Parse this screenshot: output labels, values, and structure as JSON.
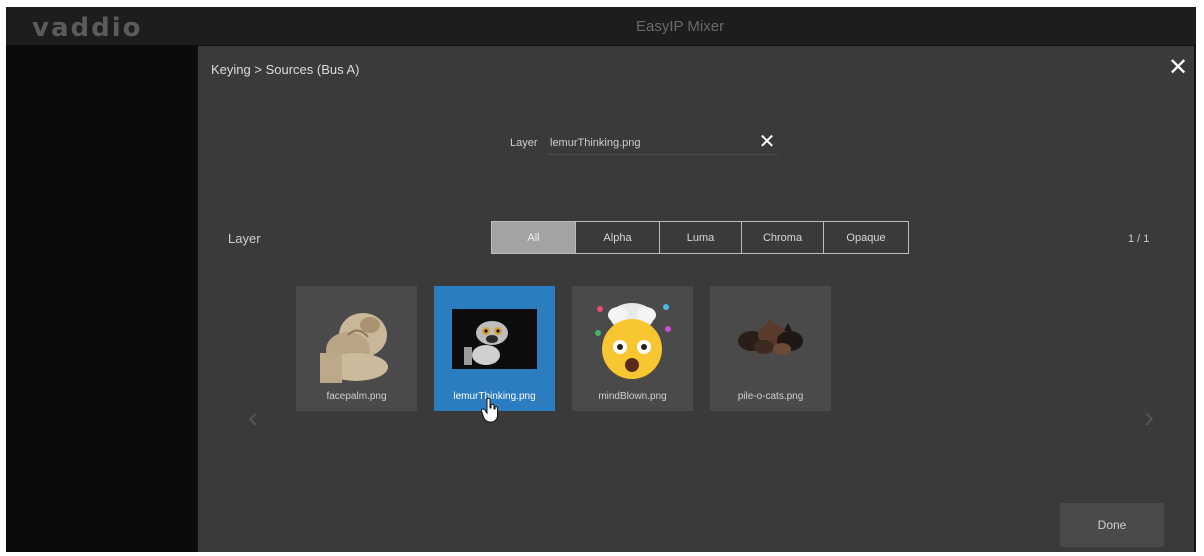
{
  "app": {
    "logo_text": "vaddio",
    "title": "EasyIP Mixer"
  },
  "modal": {
    "title": "Keying > Sources (Bus A)",
    "close_icon": "close-icon",
    "current_layer": {
      "label": "Layer",
      "value": "lemurThinking.png",
      "clear_icon": "clear-icon"
    },
    "filter_label": "Layer",
    "filters": [
      {
        "label": "All",
        "active": true
      },
      {
        "label": "Alpha",
        "active": false
      },
      {
        "label": "Luma",
        "active": false
      },
      {
        "label": "Chroma",
        "active": false
      },
      {
        "label": "Opaque",
        "active": false
      }
    ],
    "page_count": "1 / 1",
    "tiles": [
      {
        "name": "facepalm.png",
        "selected": false
      },
      {
        "name": "lemurThinking.png",
        "selected": true
      },
      {
        "name": "mindBlown.png",
        "selected": false
      },
      {
        "name": "pile-o-cats.png",
        "selected": false
      }
    ],
    "done_label": "Done"
  },
  "colors": {
    "accent": "#2b7dbf",
    "modal_bg": "#3a3a3a",
    "tile_bg": "#4a4a4a",
    "active_filter": "#a3a3a3"
  }
}
